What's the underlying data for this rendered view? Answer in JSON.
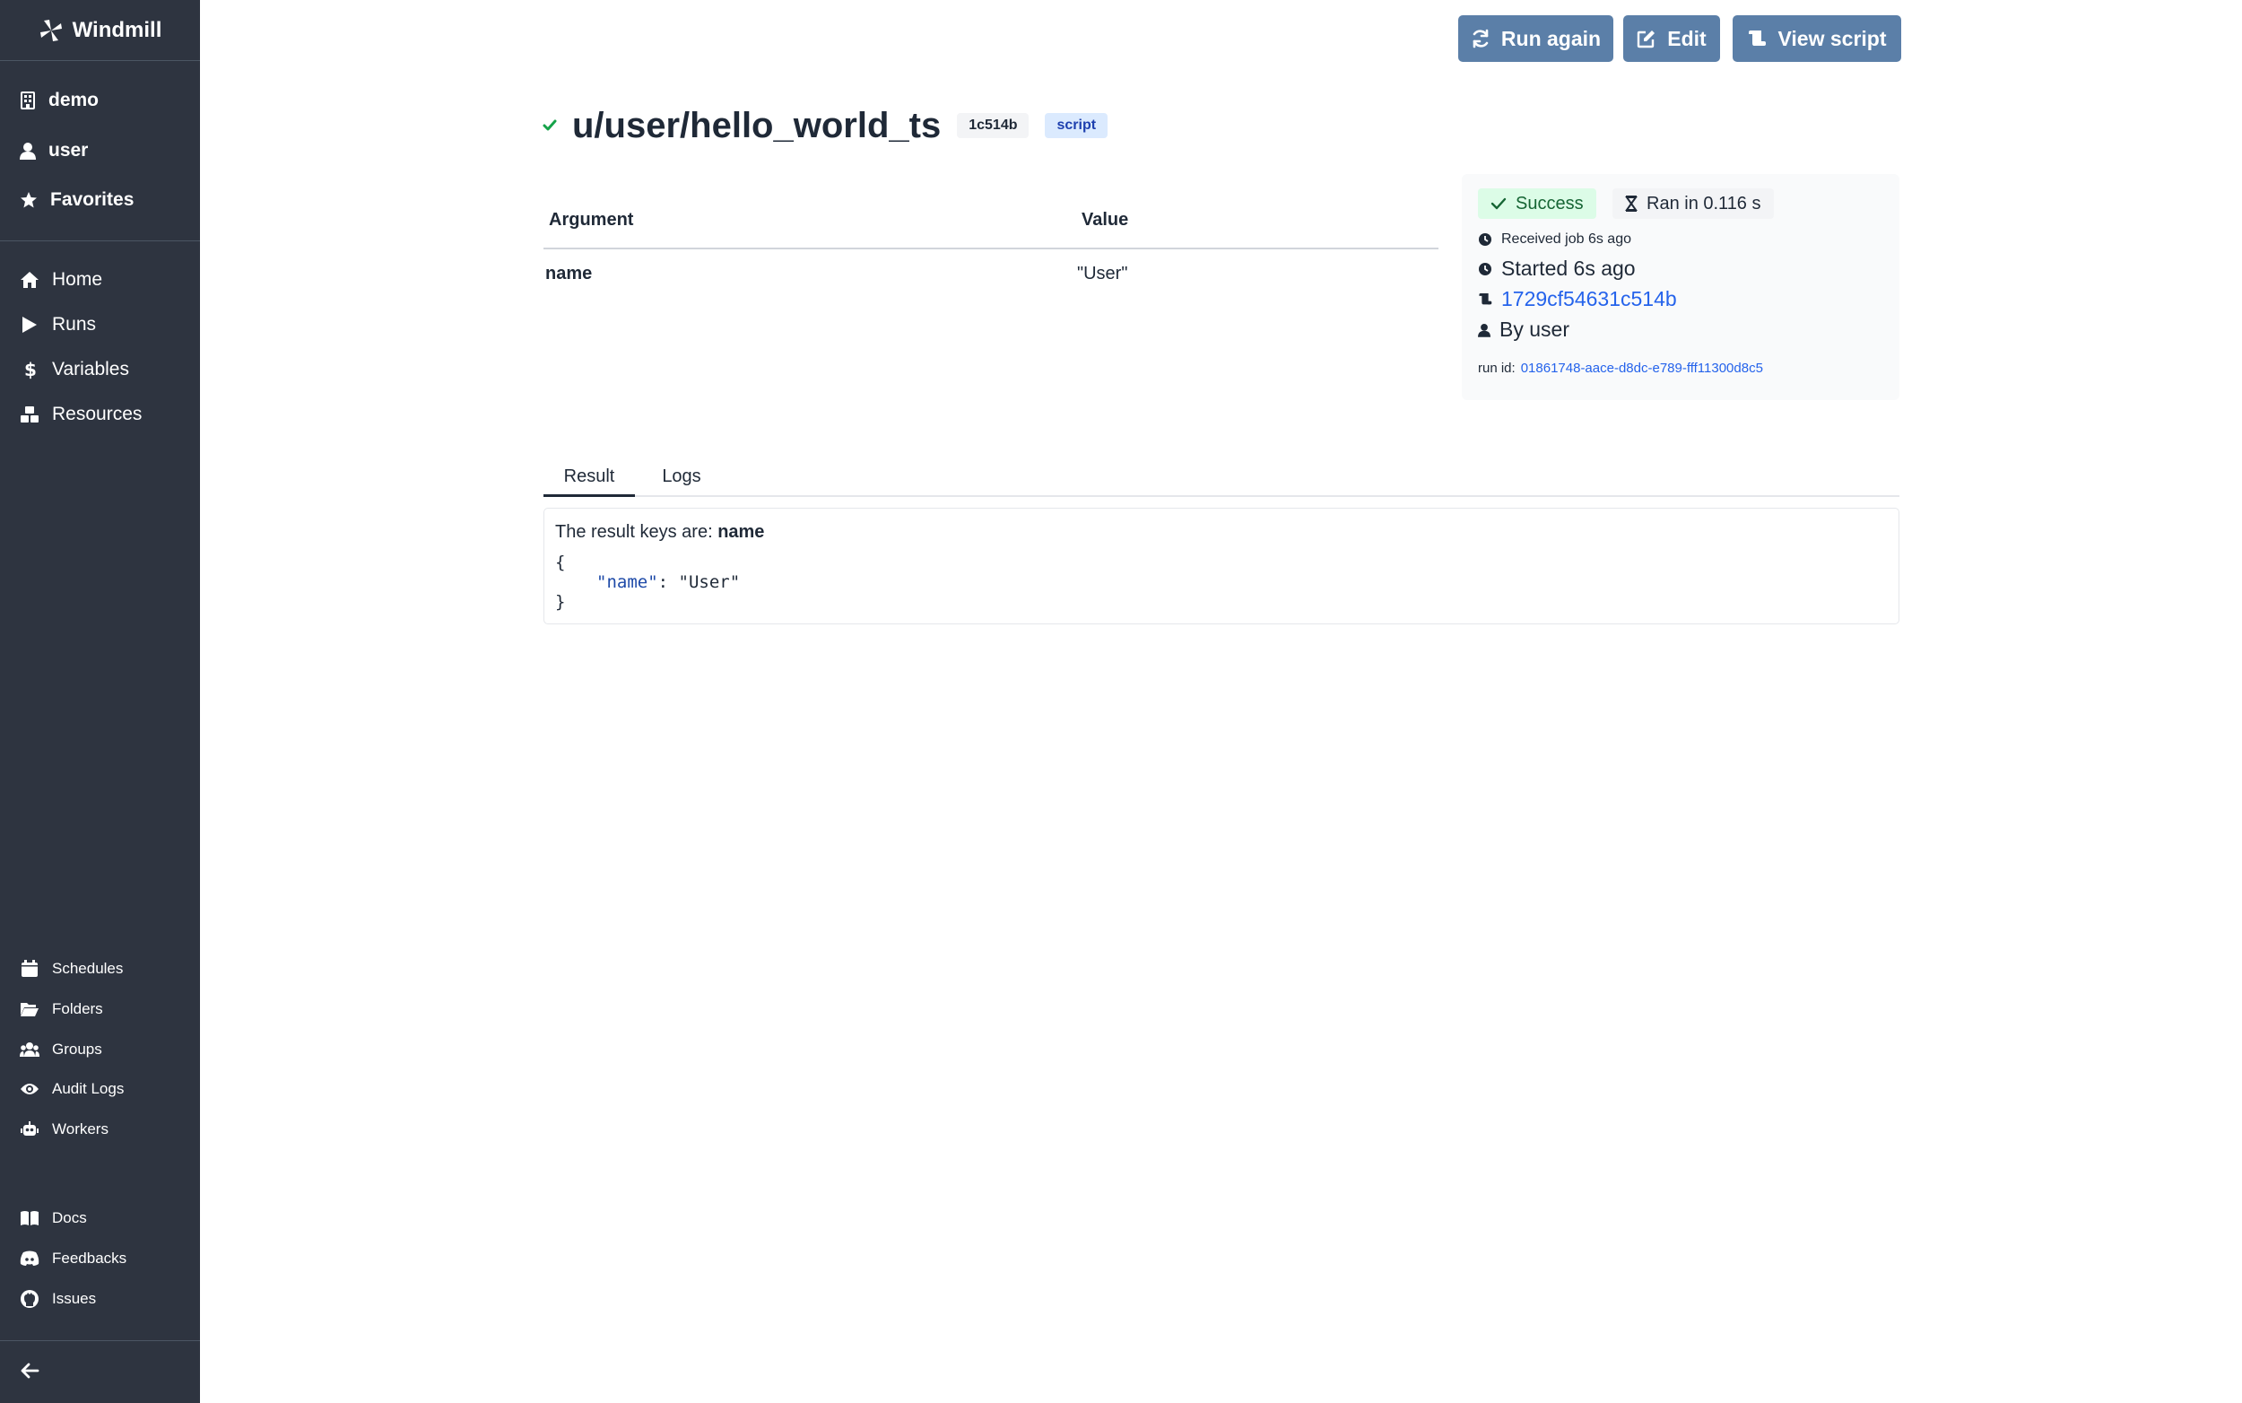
{
  "app": {
    "name": "Windmill"
  },
  "sidebar": {
    "top": [
      {
        "label": "demo",
        "icon": "building-icon"
      },
      {
        "label": "user",
        "icon": "user-icon"
      },
      {
        "label": "Favorites",
        "icon": "star-icon"
      }
    ],
    "main": [
      {
        "label": "Home",
        "icon": "home-icon"
      },
      {
        "label": "Runs",
        "icon": "play-icon"
      },
      {
        "label": "Variables",
        "icon": "dollar-icon"
      },
      {
        "label": "Resources",
        "icon": "cubes-icon"
      }
    ],
    "secondary": [
      {
        "label": "Schedules",
        "icon": "calendar-icon"
      },
      {
        "label": "Folders",
        "icon": "folder-open-icon"
      },
      {
        "label": "Groups",
        "icon": "users-icon"
      },
      {
        "label": "Audit Logs",
        "icon": "eye-icon"
      },
      {
        "label": "Workers",
        "icon": "robot-icon"
      }
    ],
    "footer": [
      {
        "label": "Docs",
        "icon": "book-icon"
      },
      {
        "label": "Feedbacks",
        "icon": "discord-icon"
      },
      {
        "label": "Issues",
        "icon": "github-icon"
      }
    ]
  },
  "toolbar": {
    "run_again": "Run again",
    "edit": "Edit",
    "view_script": "View script"
  },
  "job": {
    "path": "u/user/hello_world_ts",
    "hash_badge": "1c514b",
    "kind_badge": "script"
  },
  "args_table": {
    "headers": {
      "argument": "Argument",
      "value": "Value"
    },
    "rows": [
      {
        "argument": "name",
        "value": "\"User\""
      }
    ]
  },
  "status": {
    "success_label": "Success",
    "duration_label": "Ran in 0.116 s",
    "received": "Received job 6s ago",
    "started": "Started 6s ago",
    "script_hash": "1729cf54631c514b",
    "by_user": "By user",
    "run_id_label": "run id:",
    "run_id": "01861748-aace-d8dc-e789-fff11300d8c5"
  },
  "tabs": {
    "result": "Result",
    "logs": "Logs",
    "active": "Result"
  },
  "result": {
    "keys_label": "The result keys are:",
    "keys": "name",
    "open_brace": "{",
    "close_brace": "}",
    "json_key": "\"name\"",
    "json_value": "\"User\""
  },
  "colors": {
    "sidebar_bg": "#2e3440",
    "button_bg": "#5b7fa8",
    "success_bg": "#dcfce7",
    "success_text": "#166534",
    "link": "#2563eb"
  }
}
